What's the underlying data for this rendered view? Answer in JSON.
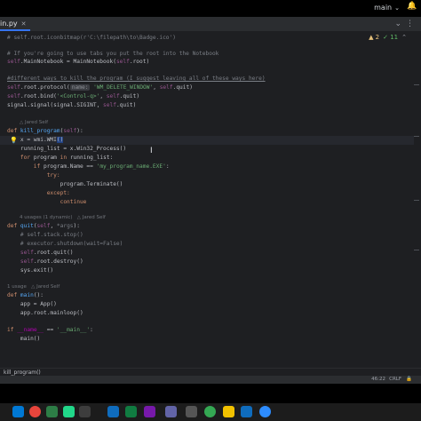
{
  "header": {
    "branch": "main",
    "file_tab": "in.py"
  },
  "inspections": {
    "warnings": "▲ 2",
    "ok": "✓ 11"
  },
  "code": {
    "l1": "# self.root.iconbitmap(r'C:\\filepath\\to\\Badge.ico')",
    "l2": "# If you're going to use tabs you put the root into the Notebook",
    "l3a": "self",
    "l3b": ".MainNotebook = MainNotebook(",
    "l3c": "self",
    "l3d": ".root)",
    "l4": "#different ways to kill the program (I suggest leaving all of these ways here)",
    "l5a": "self",
    "l5b": ".root.protocol(",
    "l5c": "name:",
    "l5d": "'WM_DELETE_WINDOW'",
    "l5e": ", ",
    "l5f": "self",
    "l5g": ".quit)",
    "l6a": "self",
    "l6b": ".root.bind(",
    "l6c": "'<Control-q>'",
    "l6d": ", ",
    "l6e": "self",
    "l6f": ".quit)",
    "l7a": "signal.signal(signal.SIGINT, ",
    "l7b": "self",
    "l7c": ".quit)",
    "h1": "△ Jared Self",
    "l8a": "def ",
    "l8b": "kill_program",
    "l8c": "(",
    "l8d": "self",
    "l8e": "):",
    "l9a": "    x = wmi.WMI",
    "l9b": "()",
    "l10": "    running_list = x.Win32_Process()",
    "l11a": "    for ",
    "l11b": "program ",
    "l11c": "in ",
    "l11d": "running_list:",
    "l12a": "        if ",
    "l12b": "program.Name == ",
    "l12c": "'my_program_name.EXE'",
    "l12d": ":",
    "l13": "            try:",
    "l14": "                program.Terminate()",
    "l15": "            except:",
    "l16": "                continue",
    "h2": "4 usages (1 dynamic)   △ Jared Self",
    "l17a": "def ",
    "l17b": "quit",
    "l17c": "(",
    "l17d": "self",
    "l17e": ", ",
    "l17f": "*args",
    "l17g": "):",
    "l18": "    # self.stack.stop()",
    "l19": "    # executor.shutdown(wait=False)",
    "l20a": "    ",
    "l20b": "self",
    "l20c": ".root.quit()",
    "l21a": "    ",
    "l21b": "self",
    "l21c": ".root.destroy()",
    "l22": "    sys.exit()",
    "h3": "1 usage   △ Jared Self",
    "l23a": "def ",
    "l23b": "main",
    "l23c": "():",
    "l24": "    app = App()",
    "l25": "    app.root.mainloop()",
    "l26a": "if ",
    "l26b": "__name__",
    "l26c": " == ",
    "l26d": "'__main__'",
    "l26e": ":",
    "l27": "    main()"
  },
  "breadcrumb": "kill_program()",
  "status": {
    "position": "46:22",
    "encoding": "CRLF",
    "lock_icon": "🔒"
  },
  "taskbar_icons": [
    {
      "name": "windows-start-icon",
      "color": "#0078d4"
    },
    {
      "name": "chrome-icon",
      "color": "#e8453c"
    },
    {
      "name": "photos-icon",
      "color": "#2d7d46"
    },
    {
      "name": "pycharm-icon",
      "color": "#21d789"
    },
    {
      "name": "chat-icon",
      "color": "#3d3d3d"
    },
    {
      "name": "terminal-icon",
      "color": "#0f6cbd"
    },
    {
      "name": "excel-icon",
      "color": "#107c41"
    },
    {
      "name": "onenote-icon",
      "color": "#7719aa"
    },
    {
      "name": "teams-icon",
      "color": "#6264a7"
    },
    {
      "name": "dots-icon",
      "color": "#555555"
    },
    {
      "name": "chrome-profile-icon",
      "color": "#34a853"
    },
    {
      "name": "paint-icon",
      "color": "#f2c200"
    },
    {
      "name": "outlook-icon",
      "color": "#0f6cbd"
    },
    {
      "name": "zoom-icon",
      "color": "#2d8cff"
    }
  ]
}
